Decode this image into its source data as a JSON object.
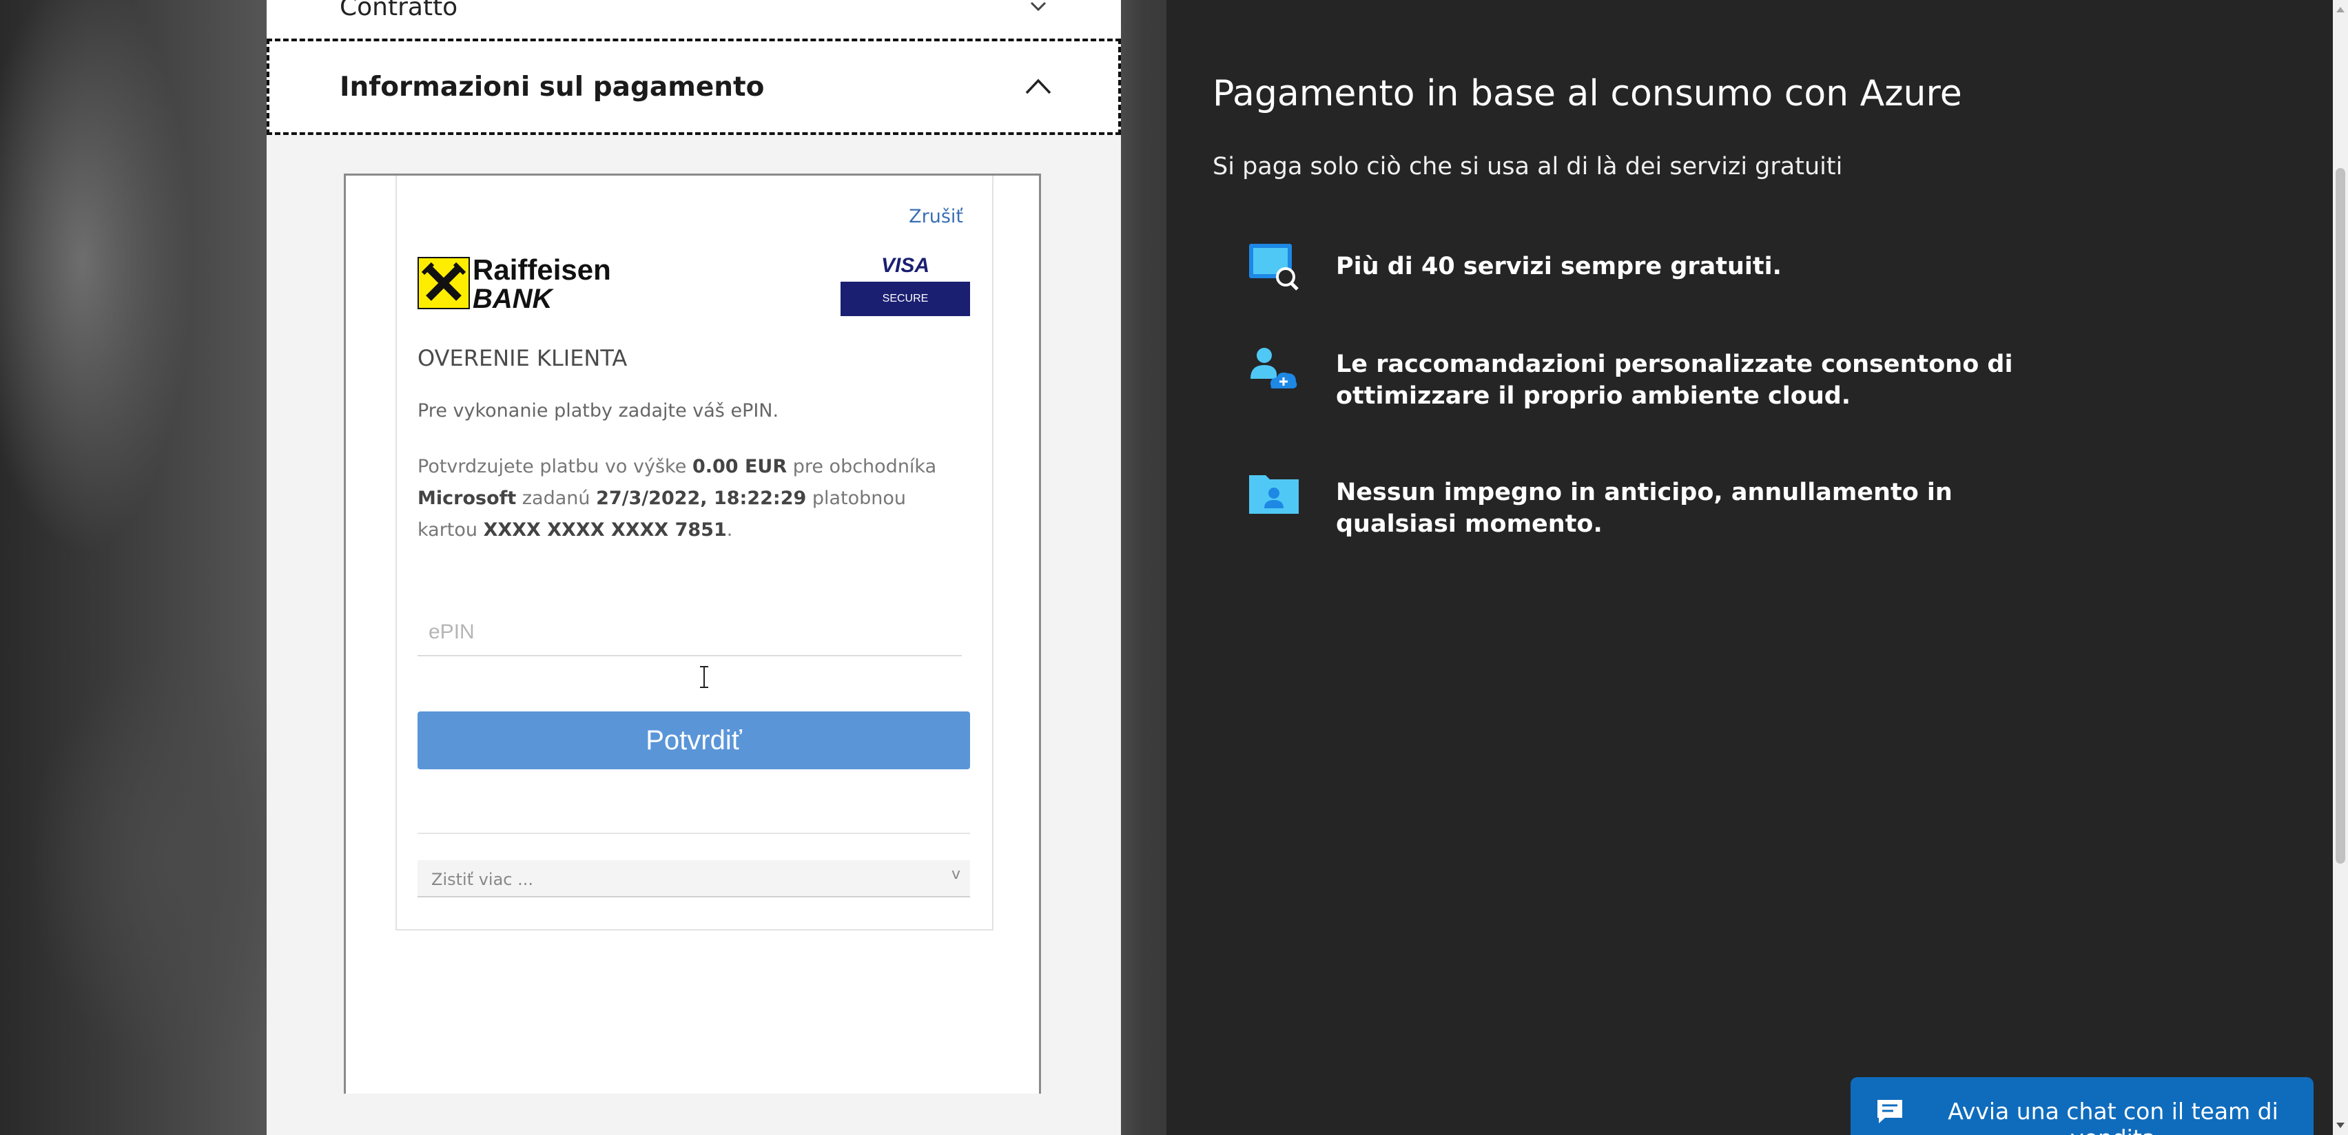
{
  "form": {
    "contract_label": "Contratto",
    "payment_title": "Informazioni sul pagamento"
  },
  "bank_auth": {
    "cancel_label": "Zrušiť",
    "bank_name_line1": "Raiffeisen",
    "bank_name_line2": "BANK",
    "visa_text": "VISA",
    "visa_secure": "SECURE",
    "title": "OVERENIE KLIENTA",
    "instruction": "Pre vykonanie platby zadajte váš ePIN.",
    "confirm_prefix": "Potvrdzujete platbu vo výške ",
    "amount": "0.00 EUR",
    "merchant_prefix": " pre obchodníka ",
    "merchant": "Microsoft",
    "date_prefix": " zadanú ",
    "datetime": "27/3/2022, 18:22:29",
    "card_prefix": " platobnou kartou ",
    "card_number": "XXXX XXXX XXXX 7851",
    "epin_placeholder": "ePIN",
    "epin_value": "",
    "confirm_button": "Potvrdiť",
    "learn_more": "Zistiť viac ...",
    "learn_more_caret": "v",
    "brand_yellow": "#ffed00",
    "button_color": "#5a95d8"
  },
  "info": {
    "title": "Pagamento in base al consumo con Azure",
    "subtitle": "Si paga solo ciò che si usa al di là dei servizi gratuiti",
    "features": [
      {
        "icon": "monitor-search-icon",
        "text": "Più di 40 servizi sempre gratuiti."
      },
      {
        "icon": "user-cloud-icon",
        "text": "Le raccomandazioni personalizzate consentono di ottimizzare il proprio ambiente cloud."
      },
      {
        "icon": "folder-user-icon",
        "text": "Nessun impegno in anticipo, annullamento in qualsiasi momento."
      }
    ],
    "accent_color": "#50c8f5"
  },
  "chat": {
    "label": "Avvia una chat con il team di vendita",
    "color": "#0f6cbd"
  }
}
